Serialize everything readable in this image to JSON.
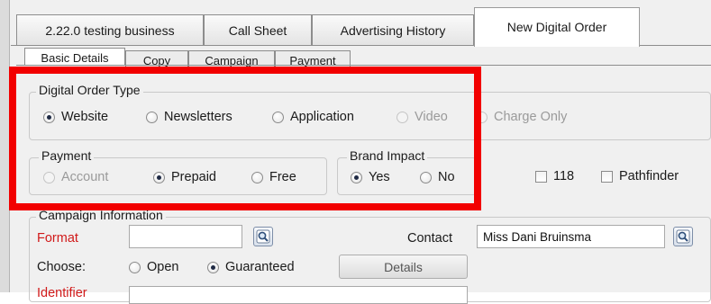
{
  "tabs": [
    {
      "label": "2.22.0 testing business",
      "active": false
    },
    {
      "label": "Call Sheet",
      "active": false
    },
    {
      "label": "Advertising History",
      "active": false
    },
    {
      "label": "New Digital Order",
      "active": true
    }
  ],
  "subtabs": [
    {
      "label": "Basic Details",
      "active": true
    },
    {
      "label": "Copy",
      "active": false
    },
    {
      "label": "Campaign",
      "active": false
    },
    {
      "label": "Payment",
      "active": false
    }
  ],
  "digital_order_type": {
    "legend": "Digital Order Type",
    "options": [
      {
        "label": "Website",
        "checked": true,
        "disabled": false
      },
      {
        "label": "Newsletters",
        "checked": false,
        "disabled": false
      },
      {
        "label": "Application",
        "checked": false,
        "disabled": false
      },
      {
        "label": "Video",
        "checked": false,
        "disabled": true
      },
      {
        "label": "Charge Only",
        "checked": false,
        "disabled": true
      }
    ]
  },
  "payment": {
    "legend": "Payment",
    "options": [
      {
        "label": "Account",
        "checked": false,
        "disabled": true
      },
      {
        "label": "Prepaid",
        "checked": true,
        "disabled": false
      },
      {
        "label": "Free",
        "checked": false,
        "disabled": false
      }
    ]
  },
  "brand_impact": {
    "legend": "Brand Impact",
    "options": [
      {
        "label": "Yes",
        "checked": true
      },
      {
        "label": "No",
        "checked": false
      }
    ]
  },
  "checkboxes": [
    {
      "label": "118",
      "checked": false
    },
    {
      "label": "Pathfinder",
      "checked": false
    }
  ],
  "campaign_info": {
    "legend": "Campaign Information",
    "format_label": "Format",
    "format_value": "",
    "contact_label": "Contact",
    "contact_value": "Miss Dani Bruinsma",
    "choose_label": "Choose:",
    "choose_options": [
      {
        "label": "Open",
        "checked": false
      },
      {
        "label": "Guaranteed",
        "checked": true
      }
    ],
    "details_button": "Details",
    "identifier_label": "Identifier"
  },
  "colors": {
    "highlight": "#f20000",
    "required_label": "#d11a1a"
  },
  "icons": {
    "lookup": "magnifier-lookup-icon"
  }
}
